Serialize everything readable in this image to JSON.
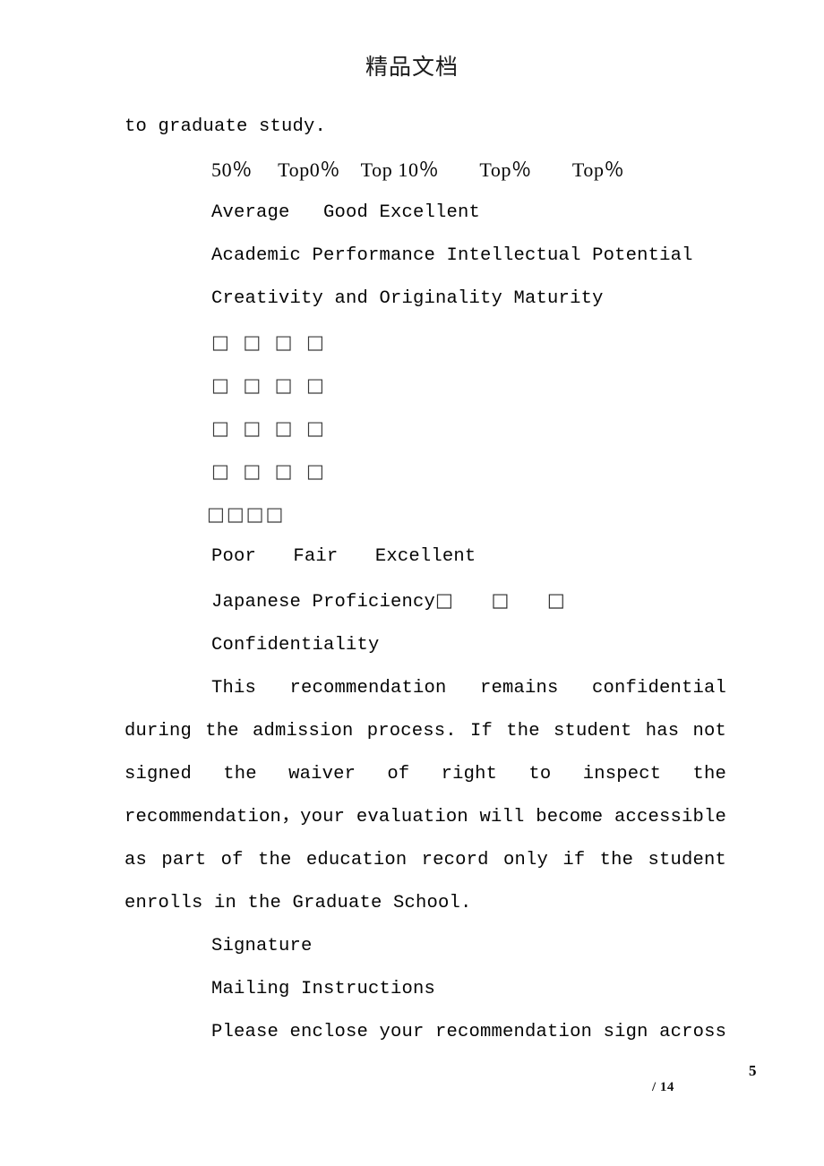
{
  "header": {
    "watermark": "精品文档"
  },
  "content": {
    "opening_line": "to graduate study.",
    "percentile_scale": "50％　 Top0％　Top 10％　　Top％　　Top％",
    "quality_scale": "Average   Good Excellent",
    "criteria_line_1": "Academic Performance Intellectual Potential",
    "criteria_line_2": "Creativity and Originality Maturity",
    "checkbox_rows": [
      {
        "name": "rating-row-1",
        "boxes": "□□□□",
        "style": "wide"
      },
      {
        "name": "rating-row-2",
        "boxes": "□□□□",
        "style": "wide"
      },
      {
        "name": "rating-row-3",
        "boxes": "□□□□",
        "style": "wide"
      },
      {
        "name": "rating-row-4",
        "boxes": "□□□□",
        "style": "wide"
      },
      {
        "name": "rating-row-5",
        "boxes": "□□□□",
        "style": "tight"
      }
    ],
    "proficiency_scale": "Poor　　Fair　　Excellent",
    "japanese_label": "Japanese Proficiency",
    "japanese_boxes": "□　　□　　□",
    "confidentiality_heading": "Confidentiality",
    "confidentiality_paragraph": "This recommendation remains confidential during the admission process. If the student has not signed the waiver of right to inspect the recommendation，your evaluation will become accessible as part of the education record only if the student enrolls in the Graduate School.",
    "signature_heading": "Signature",
    "mailing_heading": "Mailing Instructions",
    "mailing_text": "Please enclose your recommendation sign across"
  },
  "footer": {
    "page_number": "5",
    "total_pages": "/ 14"
  }
}
